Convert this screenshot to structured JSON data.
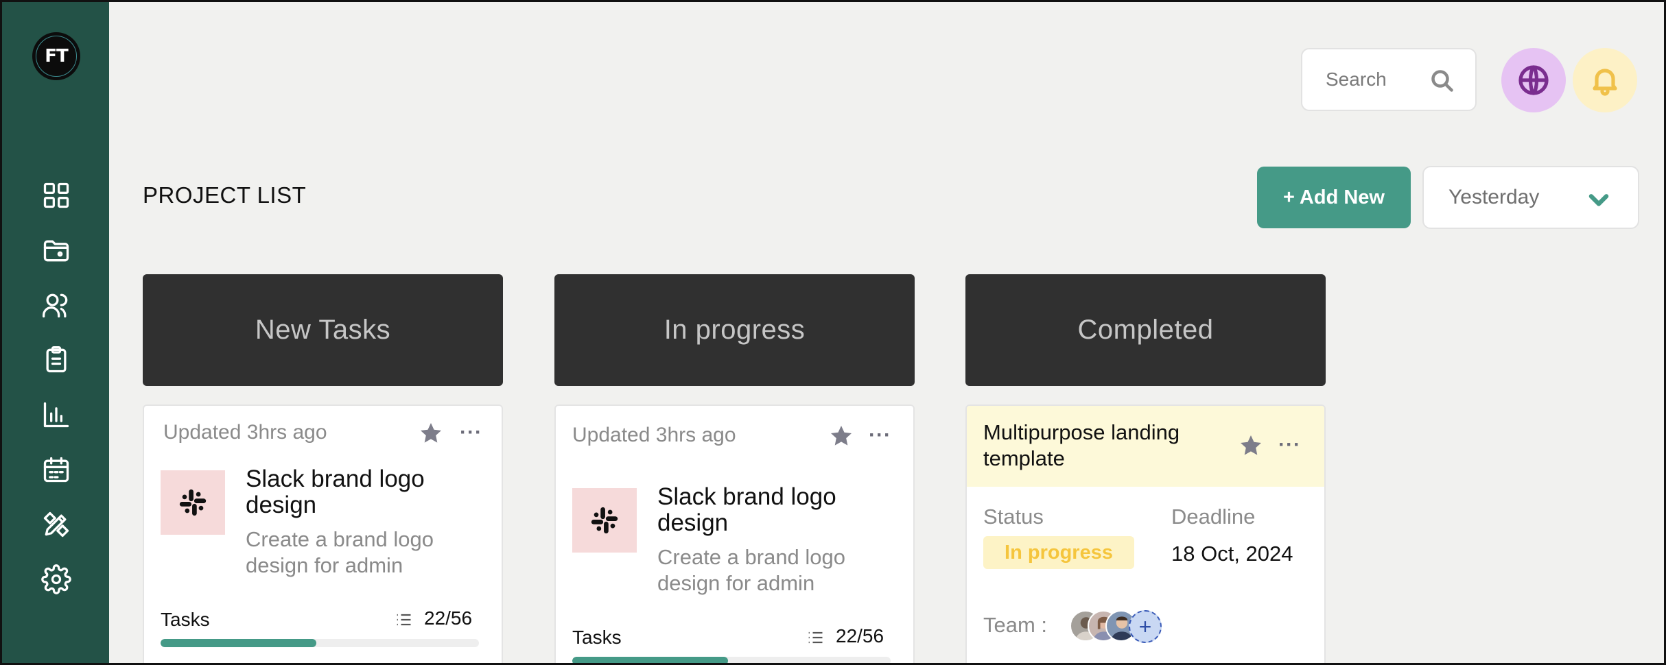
{
  "sidebar": {
    "logo_text": "FT",
    "items": [
      {
        "icon": "grid-icon"
      },
      {
        "icon": "folder-icon"
      },
      {
        "icon": "users-icon"
      },
      {
        "icon": "clipboard-icon"
      },
      {
        "icon": "bar-chart-icon"
      },
      {
        "icon": "calendar-icon"
      },
      {
        "icon": "design-tools-icon"
      },
      {
        "icon": "gear-icon"
      }
    ]
  },
  "header": {
    "search_placeholder": "Search",
    "globe_bg": "#e6c3f3",
    "bell_bg": "#fdf1c6"
  },
  "page": {
    "title": "PROJECT LIST",
    "add_button": "+ Add New",
    "date_filter": "Yesterday"
  },
  "columns": [
    {
      "title": "New Tasks"
    },
    {
      "title": "In progress"
    },
    {
      "title": "Completed"
    }
  ],
  "cards": [
    {
      "updated": "Updated 3hrs ago",
      "title": "Slack brand logo design",
      "description": "Create a brand logo design for admin",
      "tasks_label": "Tasks",
      "tasks_count": "22/56",
      "progress": 0.49
    },
    {
      "updated": "Updated 3hrs ago",
      "title": "Slack brand logo design",
      "description": "Create a brand logo design for admin",
      "tasks_label": "Tasks",
      "tasks_count": "22/56",
      "progress": 0.49
    }
  ],
  "completed_card": {
    "title": "Multipurpose landing template",
    "status_label": "Status",
    "status_value": "In progress",
    "deadline_label": "Deadline",
    "deadline_value": "18 Oct, 2024",
    "team_label": "Team :",
    "add_member_symbol": "+"
  },
  "colors": {
    "sidebar": "#235247",
    "accent": "#459a87",
    "column_header": "#303030",
    "brand_tile": "#f6dada",
    "status_text": "#f5c53d"
  }
}
